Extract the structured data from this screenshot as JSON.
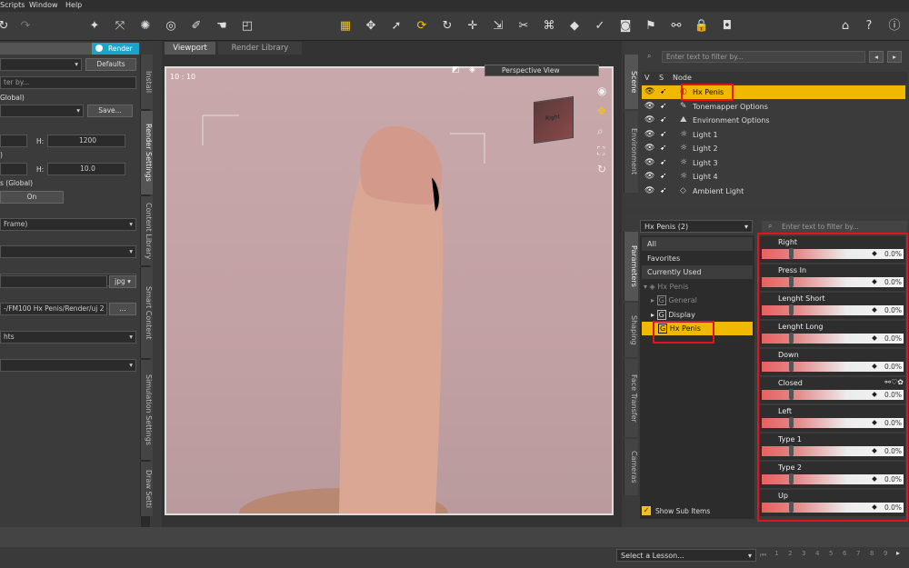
{
  "menu": [
    "Scripts",
    "Window",
    "Help"
  ],
  "left": {
    "render_tab": "Render",
    "defaults": "Defaults",
    "filter_placeholder": "ter by...",
    "preset_label": "Global)",
    "save_button": "Save...",
    "h_label": "H:",
    "h_value": "1200",
    "frame_label": ")",
    "h2_label": "H:",
    "h2_value": "10.0",
    "global_label": "s (Global)",
    "on_label": "On",
    "frame_dropdown": "Frame)",
    "format": "jpg",
    "path": "-/FM100 Hx Penis/Render/uj 2",
    "path_btn": "...",
    "lights": "hts",
    "side_tabs": [
      "Install",
      "Render Settings",
      "Content Library",
      "Smart Content",
      "Simulation Settings",
      "Draw Setti"
    ]
  },
  "viewport": {
    "tabs": [
      "Viewport",
      "Render Library"
    ],
    "frame": "10 : 10",
    "view_mode": "Perspective View",
    "cube_label": "Right"
  },
  "scene": {
    "filter_placeholder": "Enter text to filter by...",
    "side_tabs": [
      "Scene",
      "Environment"
    ],
    "cols": [
      "V",
      "S",
      "Node"
    ],
    "nodes": [
      "Hx Penis",
      "Tonemapper Options",
      "Environment Options",
      "Light 1",
      "Light 2",
      "Light 3",
      "Light 4",
      "Ambient Light"
    ]
  },
  "params": {
    "side_tabs": [
      "Parameters",
      "Shaping",
      "Face Transfer",
      "Cameras"
    ],
    "object": "Hx Penis (2)",
    "filter_placeholder": "Enter text to filter by...",
    "categories": [
      "All",
      "Favorites",
      "Currently Used"
    ],
    "tree_root": "Hx Penis",
    "tree": [
      "General",
      "Display",
      "Hx Penis"
    ],
    "show_sub": "Show Sub Items",
    "properties": [
      {
        "name": "Right",
        "value": "0.0%"
      },
      {
        "name": "Press In",
        "value": "0.0%"
      },
      {
        "name": "Lenght Short",
        "value": "0.0%"
      },
      {
        "name": "Lenght Long",
        "value": "0.0%"
      },
      {
        "name": "Down",
        "value": "0.0%"
      },
      {
        "name": "Closed",
        "value": "0.0%"
      },
      {
        "name": "Left",
        "value": "0.0%"
      },
      {
        "name": "Type 1",
        "value": "0.0%"
      },
      {
        "name": "Type 2",
        "value": "0.0%"
      },
      {
        "name": "Up",
        "value": "0.0%"
      }
    ]
  },
  "bottom": {
    "lesson": "Select a Lesson...",
    "pages": [
      "1",
      "2",
      "3",
      "4",
      "5",
      "6",
      "7",
      "8",
      "9"
    ]
  },
  "colors": {
    "selected": "#f0b800",
    "highlight": "#e0141e",
    "accent": "#1ea3c8"
  }
}
